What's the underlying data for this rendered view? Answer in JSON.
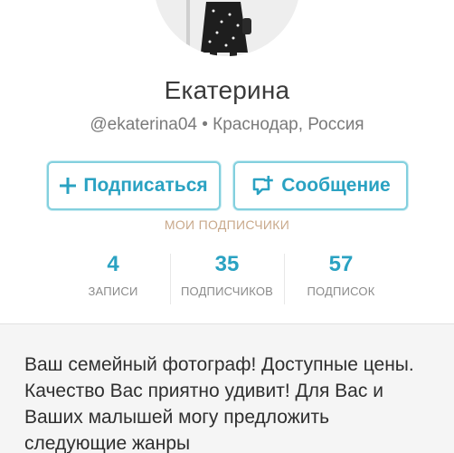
{
  "profile": {
    "name": "Екатерина",
    "handle_line": "@ekaterina04 • Краснодар, Россия"
  },
  "actions": {
    "follow_label": "Подписаться",
    "follow_icon": "plus-icon",
    "message_label": "Сообщение",
    "message_icon": "chat-plus-icon"
  },
  "my_subscribers_link": "МОИ ПОДПИСЧИКИ",
  "stats": [
    {
      "value": "4",
      "label": "записи"
    },
    {
      "value": "35",
      "label": "подписчиков"
    },
    {
      "value": "57",
      "label": "подписок"
    }
  ],
  "bio": "Ваш семейный фотограф! Доступные цены. Качество Вас приятно удивит! Для Вас и Ваших малышей могу предложить следующие жанры",
  "colors": {
    "accent": "#2aa2c2",
    "button_border": "#83d0de",
    "link_muted": "#c9a98b",
    "bio_background": "#f5f5f5"
  }
}
